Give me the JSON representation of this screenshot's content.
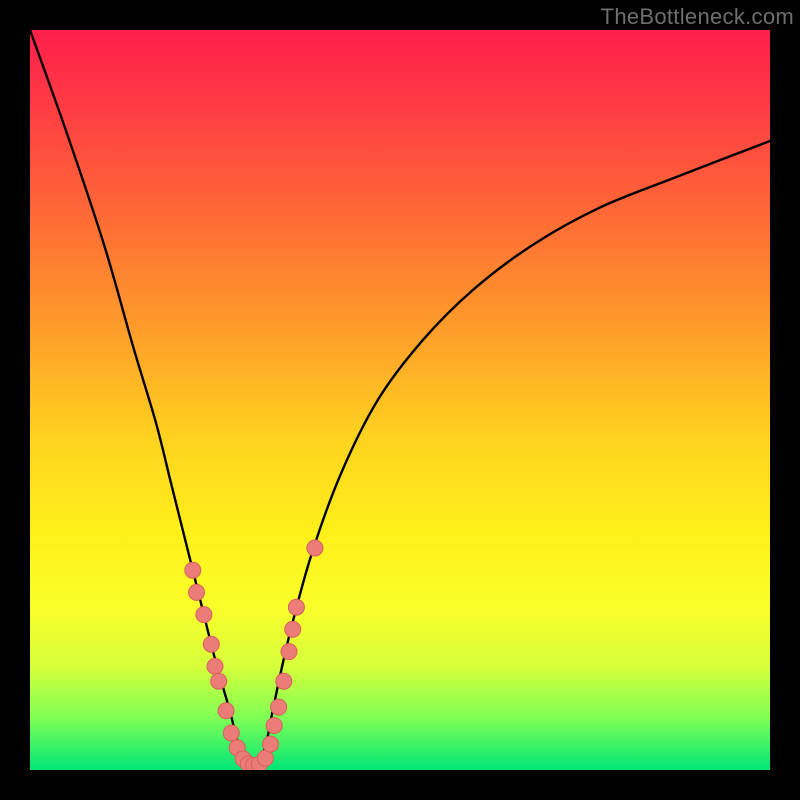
{
  "watermark": "TheBottleneck.com",
  "colors": {
    "frame": "#000000",
    "curve": "#000000",
    "dot_fill": "#ec7c78",
    "dot_stroke": "#d85f5b",
    "gradient_top": "#ff1f4b",
    "gradient_bottom": "#00e676"
  },
  "chart_data": {
    "type": "line",
    "title": "",
    "xlabel": "",
    "ylabel": "",
    "xlim": [
      0,
      100
    ],
    "ylim": [
      0,
      100
    ],
    "grid": false,
    "legend": false,
    "series": [
      {
        "name": "bottleneck-curve",
        "x": [
          0,
          5,
          10,
          14,
          17,
          19,
          21,
          23,
          25,
          27,
          28,
          29,
          30,
          31,
          32,
          33,
          35,
          38,
          42,
          47,
          53,
          60,
          68,
          77,
          87,
          100
        ],
        "y": [
          100,
          86,
          71,
          57,
          47,
          39,
          31,
          23,
          15,
          8,
          4,
          1,
          0,
          1,
          4,
          9,
          18,
          29,
          40,
          50,
          58,
          65,
          71,
          76,
          80,
          85
        ]
      }
    ],
    "scatter": {
      "name": "highlight-dots",
      "points": [
        {
          "x": 22.0,
          "y": 27
        },
        {
          "x": 22.5,
          "y": 24
        },
        {
          "x": 23.5,
          "y": 21
        },
        {
          "x": 24.5,
          "y": 17
        },
        {
          "x": 25.0,
          "y": 14
        },
        {
          "x": 25.5,
          "y": 12
        },
        {
          "x": 26.5,
          "y": 8
        },
        {
          "x": 27.2,
          "y": 5
        },
        {
          "x": 28.0,
          "y": 3
        },
        {
          "x": 28.8,
          "y": 1.5
        },
        {
          "x": 29.5,
          "y": 0.8
        },
        {
          "x": 30.2,
          "y": 0.6
        },
        {
          "x": 31.0,
          "y": 0.8
        },
        {
          "x": 31.8,
          "y": 1.6
        },
        {
          "x": 32.5,
          "y": 3.5
        },
        {
          "x": 33.0,
          "y": 6
        },
        {
          "x": 33.6,
          "y": 8.5
        },
        {
          "x": 34.3,
          "y": 12
        },
        {
          "x": 35.0,
          "y": 16
        },
        {
          "x": 35.5,
          "y": 19
        },
        {
          "x": 36.0,
          "y": 22
        },
        {
          "x": 38.5,
          "y": 30
        }
      ]
    }
  }
}
